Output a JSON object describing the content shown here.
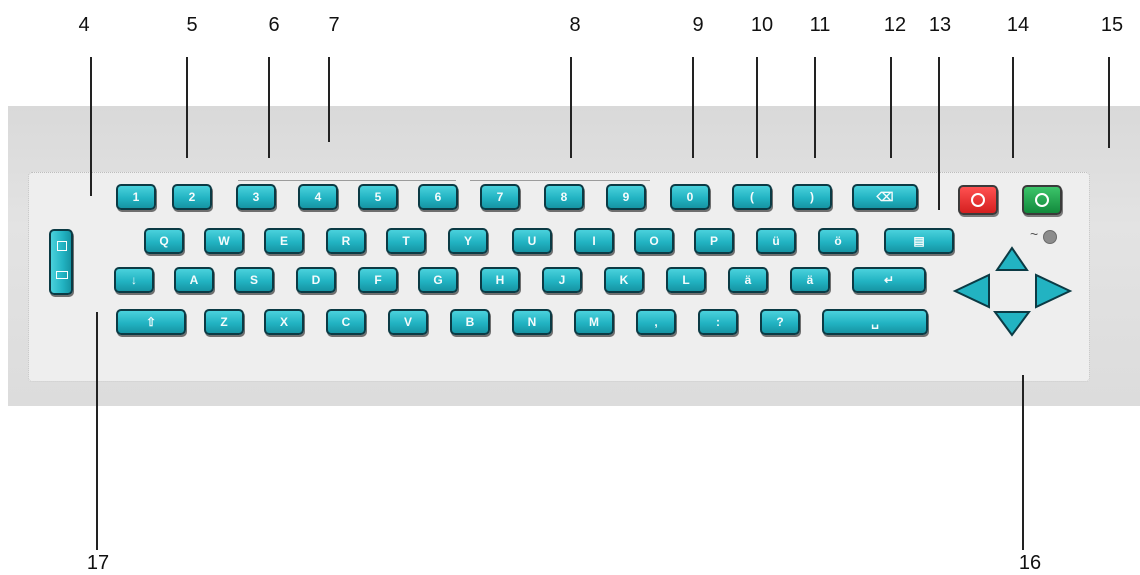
{
  "callouts": [
    "4",
    "5",
    "6",
    "7",
    "8",
    "9",
    "10",
    "11",
    "12",
    "13",
    "14",
    "15",
    "16",
    "17"
  ],
  "row1": [
    "1",
    "2",
    "3",
    "4",
    "5",
    "6",
    "7",
    "8",
    "9",
    "0",
    "(",
    ")",
    "⌫"
  ],
  "row2": [
    "Q",
    "W",
    "E",
    "R",
    "T",
    "Y",
    "U",
    "I",
    "O",
    "P",
    "ü",
    "ö",
    "▤"
  ],
  "row3": [
    "↓",
    "A",
    "S",
    "D",
    "F",
    "G",
    "H",
    "J",
    "K",
    "L",
    "ä",
    "ä",
    "↵"
  ],
  "row4": [
    "⇧",
    "Z",
    "X",
    "C",
    "V",
    "B",
    "N",
    "M",
    ",",
    ":",
    "?",
    "␣"
  ],
  "colors": {
    "key": "#22b3c2",
    "power_off": "#e02a2a",
    "power_on": "#14a04a"
  },
  "icons": [
    "power-off-icon",
    "power-on-icon",
    "arrow-up-icon",
    "arrow-left-icon",
    "arrow-right-icon",
    "arrow-down-icon",
    "status-led-icon"
  ]
}
